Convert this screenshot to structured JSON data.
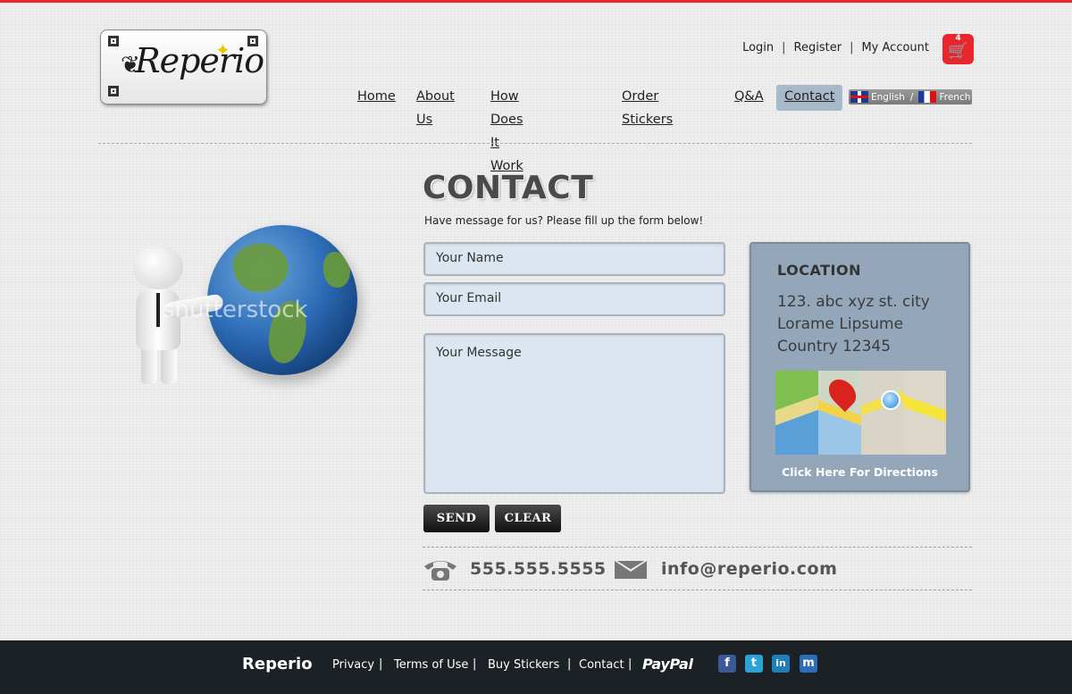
{
  "brand": {
    "logo_text": "Reperio"
  },
  "account": {
    "login": "Login",
    "register": "Register",
    "my_account": "My Account",
    "sep": "|"
  },
  "cart": {
    "count": "4",
    "icon": "cart-icon"
  },
  "nav": {
    "home": "Home",
    "about": "About Us",
    "how": "How Does It Work",
    "order": "Order Stickers",
    "qa": "Q&A",
    "contact": "Contact"
  },
  "language": {
    "english": "English",
    "sep": "/",
    "french": "French"
  },
  "illustration": {
    "watermark": "shutterstock"
  },
  "contact": {
    "title": "CONTACT",
    "subtitle": "Have message for us? Please fill up the form below!",
    "name_placeholder": "Your Name",
    "email_placeholder": "Your Email",
    "message_placeholder": "Your Message",
    "send": "SEND",
    "clear": "CLEAR"
  },
  "location": {
    "title": "LOCATION",
    "address_line1": "123. abc xyz st. city",
    "address_line2": "Lorame Lipsume",
    "address_line3": "Country 12345",
    "directions": "Click Here For Directions"
  },
  "contact_info": {
    "phone": "555.555.5555",
    "email": "info@reperio.com"
  },
  "footer": {
    "brand": "Reperio",
    "privacy": "Privacy",
    "terms": "Terms of Use",
    "buy": "Buy Stickers",
    "contact": "Contact",
    "paypal": "PayPal",
    "sep": "|",
    "social": {
      "facebook": "f",
      "twitter": "t",
      "linkedin": "in",
      "myspace": "m"
    }
  },
  "colors": {
    "accent_red": "#e8262b",
    "location_box": "#94a7ba",
    "input_bg": "#dbe6f0",
    "footer_bg": "#1c2125",
    "nav_active": "#a8b9cc"
  }
}
